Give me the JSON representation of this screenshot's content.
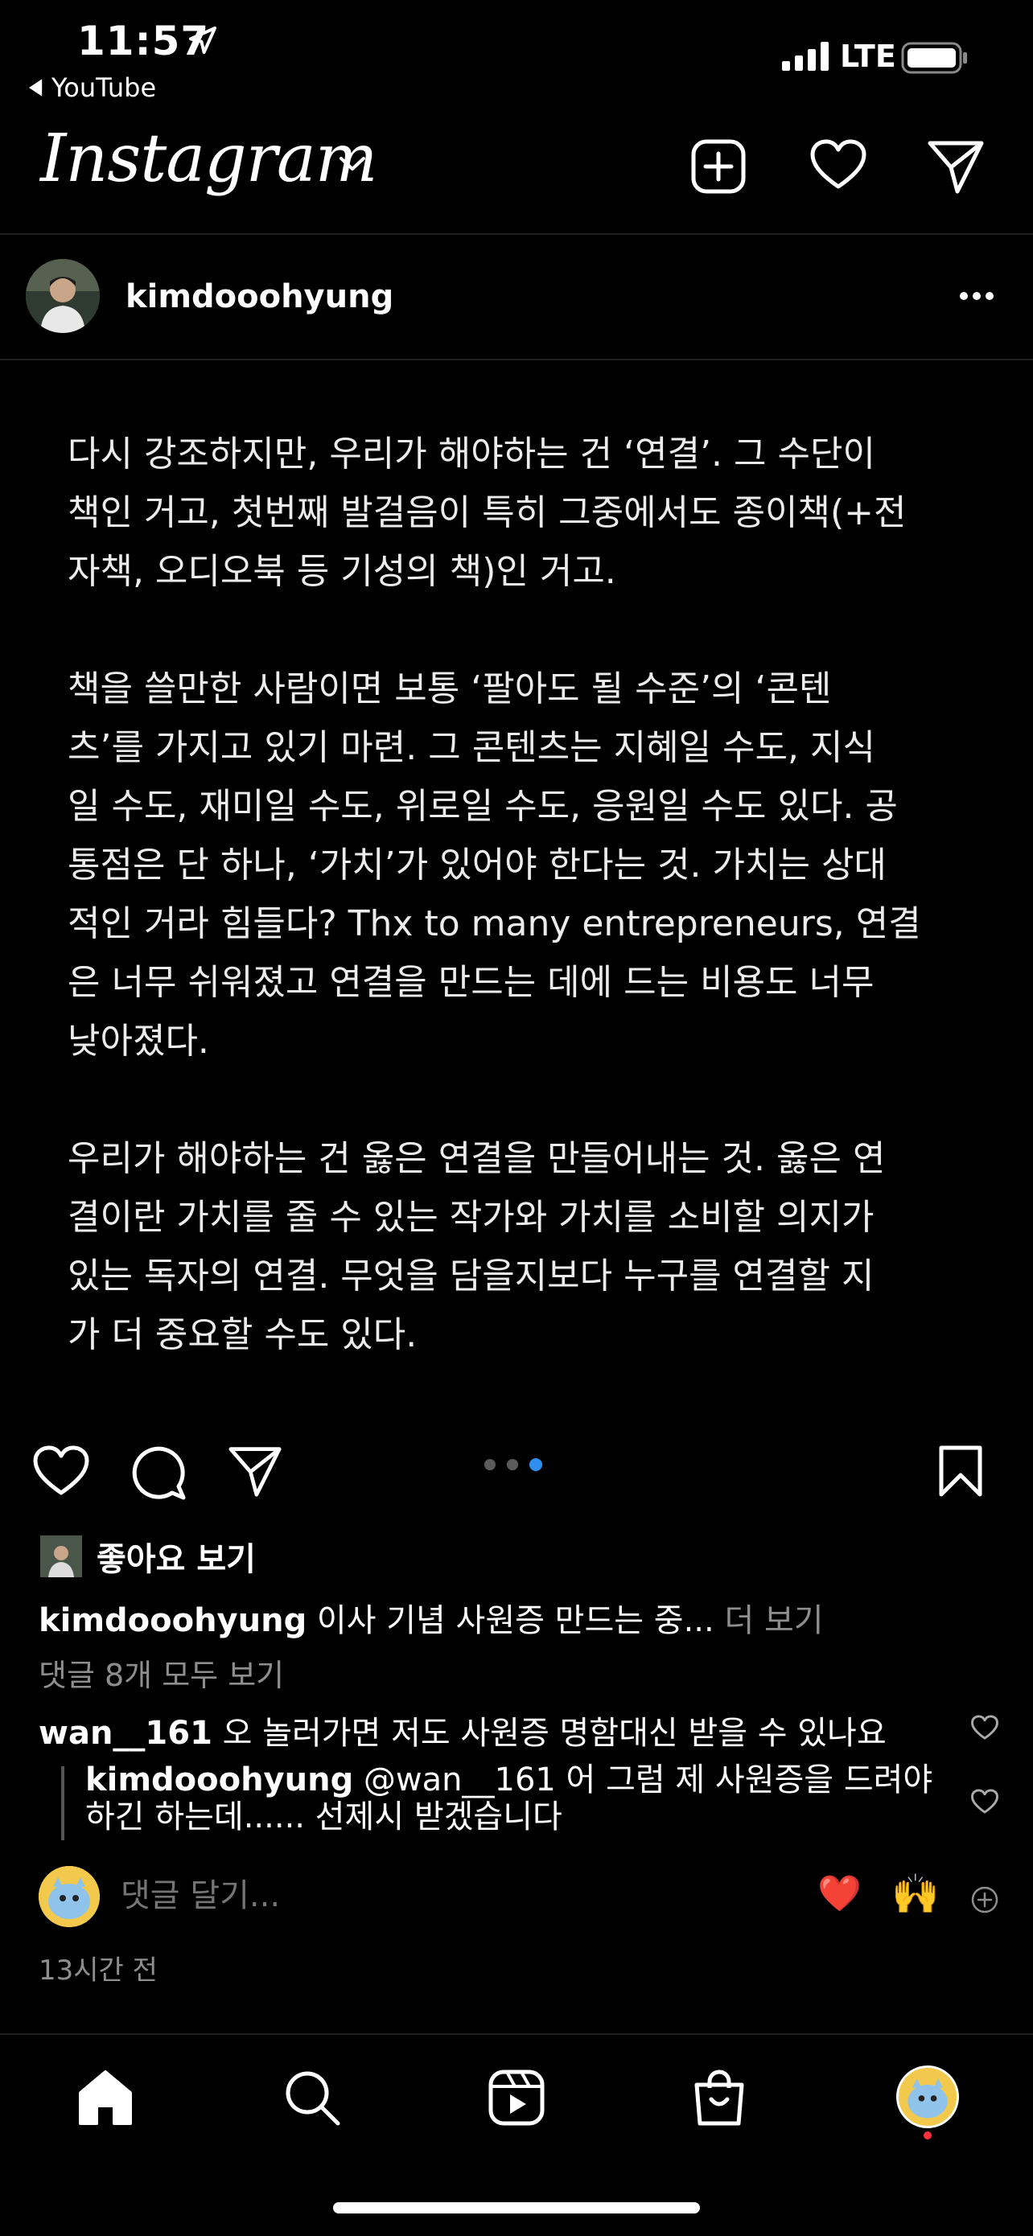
{
  "status": {
    "time": "11:57",
    "back_app": "YouTube",
    "carrier": "LTE"
  },
  "header": {
    "brand": "Instagram"
  },
  "post": {
    "username": "kimdooohyung",
    "paragraphs": [
      "다시 강조하지만, 우리가 해야하는 건 ‘연결’. 그 수단이\n책인 거고, 첫번째 발걸음이 특히 그중에서도 종이책(+전\n자책, 오디오북 등 기성의 책)인 거고.",
      "책을 쓸만한 사람이면 보통 ‘팔아도 될 수준’의 ‘콘텐\n츠’를 가지고 있기 마련. 그 콘텐츠는 지혜일 수도, 지식\n일 수도, 재미일 수도, 위로일 수도, 응원일 수도 있다. 공\n통점은 단 하나, ‘가치’가 있어야 한다는 것. 가치는 상대\n적인 거라 힘들다? Thx to many entrepreneurs, 연결\n은 너무 쉬워졌고 연결을 만드는 데에 드는 비용도 너무\n낮아졌다.",
      "우리가 해야하는 건 옳은 연결을 만들어내는 것. 옳은 연\n결이란 가치를 줄 수 있는 작가와 가치를 소비할 의지가\n있는 독자의 연결. 무엇을 담을지보다 누구를 연결할 지\n가 더 중요할 수도 있다."
    ],
    "carousel": {
      "count": 3,
      "active_index": 3
    },
    "likes_label": "좋아요 보기",
    "caption": {
      "username": "kimdooohyung",
      "text": " 이사 기념 사원증 만드는 중...",
      "more": " 더 보기"
    },
    "view_all_comments": "댓글 8개 모두 보기",
    "comments": [
      {
        "username": "wan__161",
        "text": " 오 놀러가면 저도 사원증 명함대신 받을 수 있나요"
      },
      {
        "username": "kimdooohyung",
        "text": " @wan__161 어 그럼 제 사원증을 드려야 하긴 하는데...... 선제시 받겠습니다"
      }
    ],
    "add_comment_placeholder": "댓글 달기...",
    "quick_emojis": [
      "❤️",
      "🙌"
    ],
    "timestamp": "13시간 전"
  },
  "colors": {
    "background": "#000000",
    "secondary_text": "#8e8e8e",
    "active_dot": "#2f8ef0",
    "notification_dot": "#ff3040"
  },
  "tabs": [
    "home-icon",
    "search-icon",
    "reels-icon",
    "shop-icon",
    "profile-avatar"
  ]
}
